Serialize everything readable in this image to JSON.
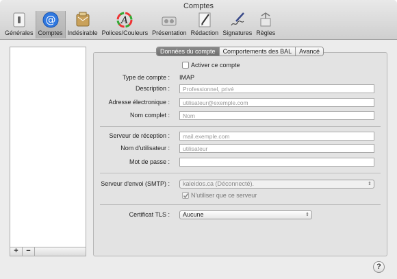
{
  "window": {
    "title": "Comptes"
  },
  "toolbar": {
    "items": [
      {
        "label": "Générales",
        "icon": "switch-icon"
      },
      {
        "label": "Comptes",
        "icon": "at-icon"
      },
      {
        "label": "Indésirable",
        "icon": "junk-mail-icon"
      },
      {
        "label": "Polices/Couleurs",
        "icon": "fonts-colors-icon"
      },
      {
        "label": "Présentation",
        "icon": "viewing-icon"
      },
      {
        "label": "Rédaction",
        "icon": "composing-icon"
      },
      {
        "label": "Signatures",
        "icon": "signature-pen-icon"
      },
      {
        "label": "Règles",
        "icon": "rules-icon"
      }
    ],
    "selected": "Comptes"
  },
  "tabs": [
    {
      "label": "Données du compte",
      "selected": true
    },
    {
      "label": "Comportements des BAL",
      "selected": false
    },
    {
      "label": "Avancé",
      "selected": false
    }
  ],
  "sidebar": {
    "add_label": "+",
    "remove_label": "−"
  },
  "form": {
    "enable_account": {
      "label": "Activer ce compte",
      "checked": false
    },
    "account_type": {
      "label": "Type de compte :",
      "value": "IMAP"
    },
    "description": {
      "label": "Description :",
      "placeholder": "Professionnel, privé",
      "value": ""
    },
    "email": {
      "label": "Adresse électronique :",
      "placeholder": "utilisateur@exemple.com",
      "value": ""
    },
    "full_name": {
      "label": "Nom complet :",
      "placeholder": "Nom",
      "value": ""
    },
    "incoming_server": {
      "label": "Serveur de réception :",
      "placeholder": "mail.exemple.com",
      "value": ""
    },
    "username": {
      "label": "Nom d'utilisateur :",
      "placeholder": "utilisateur",
      "value": ""
    },
    "password": {
      "label": "Mot de passe :",
      "value": ""
    },
    "smtp": {
      "label": "Serveur d'envoi (SMTP) :",
      "value": "kaleidos.ca (Déconnecté).",
      "arrow": "⇕"
    },
    "only_this_server": {
      "label": "N'utiliser que ce serveur",
      "checked": true
    },
    "tls": {
      "label": "Certificat TLS :",
      "value": "Aucune",
      "arrow": "⇕"
    }
  },
  "help": {
    "label": "?"
  },
  "colors": {
    "tab_selected": "#7a7a7a",
    "panel": "#e3e3e3",
    "accent_icon": "#2f78e0"
  }
}
